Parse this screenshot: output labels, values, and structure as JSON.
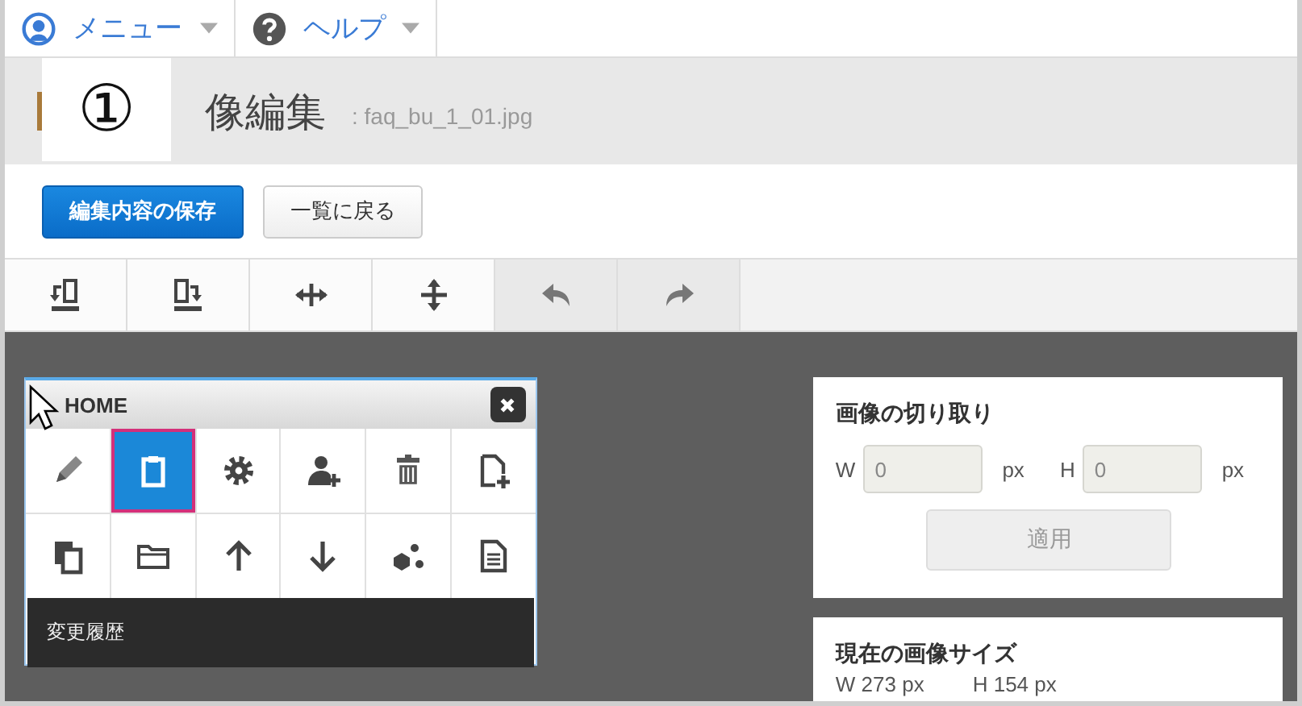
{
  "menubar": {
    "items": [
      {
        "label": "メニュー",
        "kind": "menu"
      },
      {
        "label": "ヘルプ",
        "kind": "help"
      }
    ]
  },
  "header": {
    "title": "像編集",
    "filename": ": faq_bu_1_01.jpg"
  },
  "annotation": {
    "label": "①"
  },
  "actions": [
    {
      "label": "編集内容の保存",
      "kind": "primary"
    },
    {
      "label": "一覧に戻る",
      "kind": "default"
    }
  ],
  "toolbar": [
    {
      "kind": "rotate-left",
      "disabled": false
    },
    {
      "kind": "rotate-right",
      "disabled": false
    },
    {
      "kind": "flip-horizontal",
      "disabled": false
    },
    {
      "kind": "flip-vertical",
      "disabled": false
    },
    {
      "kind": "undo",
      "disabled": true
    },
    {
      "kind": "redo",
      "disabled": true
    }
  ],
  "palette": {
    "title": "HOME",
    "items": [
      {
        "kind": "pencil",
        "selected": false
      },
      {
        "kind": "clipboard",
        "selected": true
      },
      {
        "kind": "gear",
        "selected": false
      },
      {
        "kind": "user-add",
        "selected": false
      },
      {
        "kind": "trash",
        "selected": false
      },
      {
        "kind": "file-add",
        "selected": false
      },
      {
        "kind": "copy",
        "selected": false
      },
      {
        "kind": "folder",
        "selected": false
      },
      {
        "kind": "arrow-up",
        "selected": false
      },
      {
        "kind": "arrow-down",
        "selected": false
      },
      {
        "kind": "cubes",
        "selected": false
      },
      {
        "kind": "document",
        "selected": false
      }
    ],
    "footer": "変更履歴"
  },
  "crop_panel": {
    "title": "画像の切り取り",
    "fields": [
      {
        "label": "W",
        "value": "0",
        "unit": "px"
      },
      {
        "label": "H",
        "value": "0",
        "unit": "px"
      }
    ],
    "apply_button": {
      "label": "適用",
      "disabled": true
    }
  },
  "size_panel": {
    "title": "現在の画像サイズ",
    "width": "W 273 px",
    "height": "H 154 px"
  }
}
